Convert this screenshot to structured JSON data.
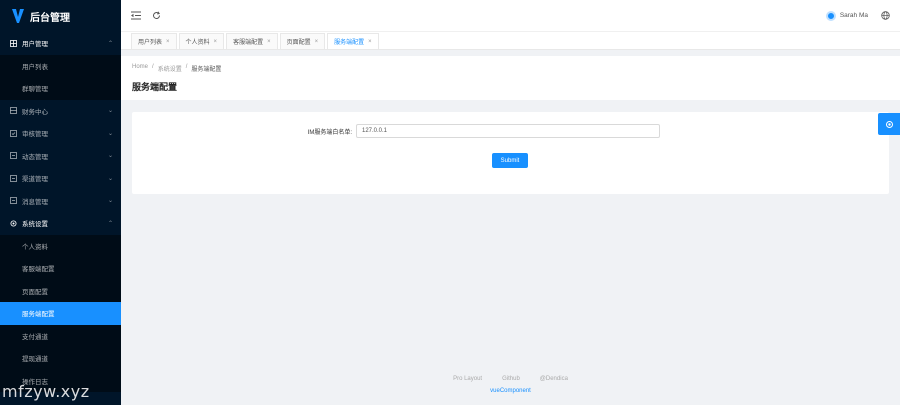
{
  "app": {
    "title": "后台管理"
  },
  "sidebar": {
    "items": [
      {
        "label": "用户管理",
        "icon": "table-icon",
        "open": true,
        "children": [
          "用户列表",
          "群聊管理"
        ]
      },
      {
        "label": "财务中心",
        "icon": "grid-icon"
      },
      {
        "label": "审核管理",
        "icon": "check-square-icon"
      },
      {
        "label": "动态管理",
        "icon": "square-icon"
      },
      {
        "label": "渠道管理",
        "icon": "square-icon"
      },
      {
        "label": "消息管理",
        "icon": "square-icon"
      },
      {
        "label": "系统设置",
        "icon": "gear-icon",
        "open": true,
        "children": [
          "个人资料",
          "客服端配置",
          "页面配置",
          "服务端配置",
          "支付通道",
          "提现通道",
          "操作日志"
        ]
      }
    ],
    "active_child": "服务端配置"
  },
  "watermark": "mfzyw.xyz",
  "header": {
    "user_name": "Sarah Ma"
  },
  "tabs": [
    {
      "label": "用户列表",
      "active": false
    },
    {
      "label": "个人资料",
      "active": false
    },
    {
      "label": "客服端配置",
      "active": false
    },
    {
      "label": "页面配置",
      "active": false
    },
    {
      "label": "服务端配置",
      "active": true
    }
  ],
  "page": {
    "breadcrumb": [
      "Home",
      "系统设置",
      "服务端配置"
    ],
    "title": "服务端配置"
  },
  "form": {
    "label": "IM服务端白名单:",
    "value": "127.0.0.1",
    "submit_label": "Submit"
  },
  "footer": {
    "links": [
      "Pro Layout",
      "Github",
      "@Dendica"
    ],
    "copyright": "vueComponent"
  },
  "colors": {
    "sidebar_bg": "#001529",
    "primary": "#1890ff",
    "page_bg": "#f0f2f5"
  }
}
